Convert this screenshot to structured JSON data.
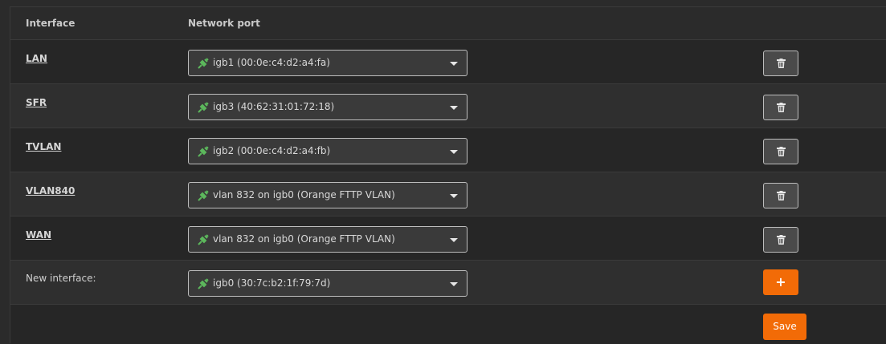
{
  "table": {
    "col_interface": "Interface",
    "col_network_port": "Network port"
  },
  "interfaces": [
    {
      "name": "LAN",
      "port": "igb1 (00:0e:c4:d2:a4:fa)"
    },
    {
      "name": "SFR",
      "port": "igb3 (40:62:31:01:72:18)"
    },
    {
      "name": "TVLAN",
      "port": "igb2 (00:0e:c4:d2:a4:fb)"
    },
    {
      "name": "VLAN840",
      "port": "vlan 832 on igb0 (Orange FTTP VLAN)"
    },
    {
      "name": "WAN",
      "port": "vlan 832 on igb0 (Orange FTTP VLAN)"
    }
  ],
  "new_interface": {
    "label": "New interface:",
    "port": "igb0 (30:7c:b2:1f:79:7d)",
    "add_label": "+"
  },
  "actions": {
    "save_label": "Save"
  },
  "icons": {
    "port": "plug-icon",
    "delete": "trash-icon",
    "dropdown": "caret-down-icon"
  },
  "colors": {
    "accent": "#f26b07",
    "plug": "#5cb85c"
  }
}
